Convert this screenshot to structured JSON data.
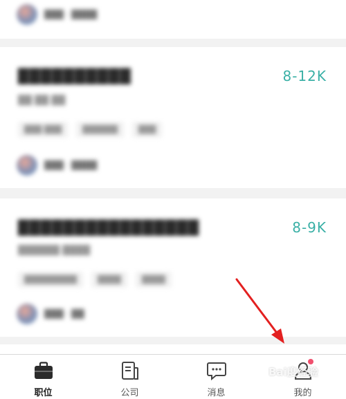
{
  "colors": {
    "accent": "#3ab0a6",
    "arrow": "#e32020",
    "badge": "#f0506e"
  },
  "jobs": [
    {
      "title": "██████████",
      "salary": "8-12K",
      "sub": "██ ██ ██",
      "tags": [
        "███ ███",
        "██████",
        "███"
      ],
      "recruiter": "███ · ████"
    },
    {
      "title": "████████████████",
      "salary": "8-9K",
      "sub": "██████ ████",
      "tags": [
        "█████████",
        "████",
        "████"
      ],
      "recruiter": "███ · ██"
    }
  ],
  "top_card": {
    "recruiter": "███ · ████"
  },
  "tabbar": {
    "tabs": [
      {
        "label": "职位",
        "icon": "briefcase-icon",
        "active": true
      },
      {
        "label": "公司",
        "icon": "company-icon",
        "active": false
      },
      {
        "label": "消息",
        "icon": "message-icon",
        "active": false
      },
      {
        "label": "我的",
        "icon": "profile-icon",
        "active": false
      }
    ]
  },
  "watermark": "Bai度经验"
}
